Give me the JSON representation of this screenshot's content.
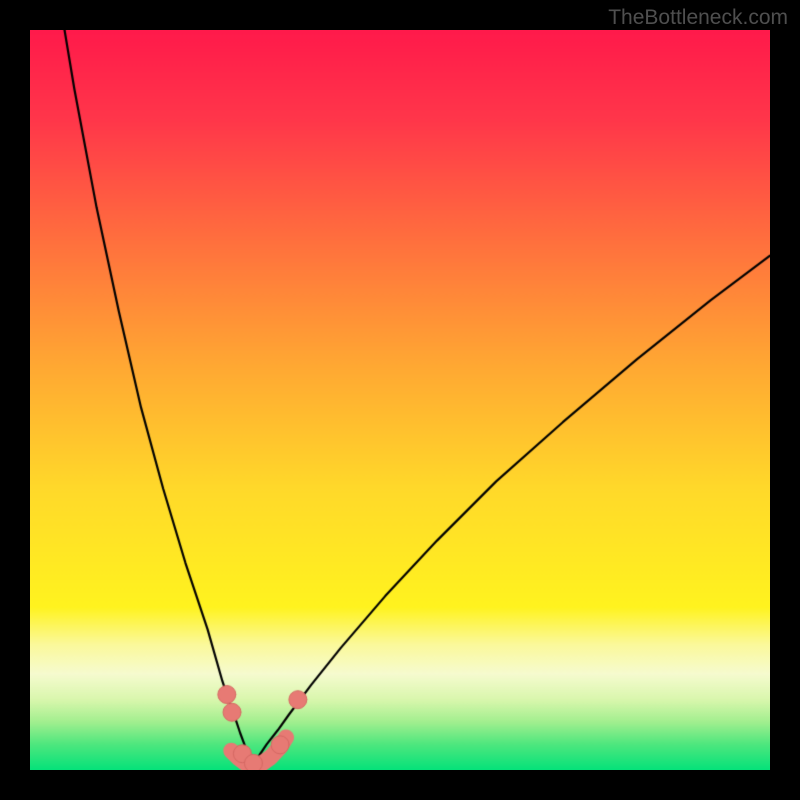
{
  "watermark": "TheBottleneck.com",
  "colors": {
    "black": "#000000",
    "curve": "#000000",
    "marker_fill": "#e77a74",
    "marker_stroke": "#d56863",
    "gradient_stops": [
      {
        "offset": 0.0,
        "color": "#ff1a4b"
      },
      {
        "offset": 0.12,
        "color": "#ff364a"
      },
      {
        "offset": 0.28,
        "color": "#ff6e3e"
      },
      {
        "offset": 0.45,
        "color": "#ffa733"
      },
      {
        "offset": 0.62,
        "color": "#ffd92a"
      },
      {
        "offset": 0.78,
        "color": "#fff31f"
      },
      {
        "offset": 0.83,
        "color": "#fbf99a"
      },
      {
        "offset": 0.87,
        "color": "#f6fbcf"
      },
      {
        "offset": 0.905,
        "color": "#d9f7ad"
      },
      {
        "offset": 0.935,
        "color": "#a2ef8f"
      },
      {
        "offset": 0.965,
        "color": "#4fe77e"
      },
      {
        "offset": 1.0,
        "color": "#05e27a"
      }
    ]
  },
  "chart_data": {
    "type": "line",
    "title": "",
    "xlabel": "",
    "ylabel": "",
    "xlim": [
      0,
      100
    ],
    "ylim": [
      0,
      100
    ],
    "x_of_min": 30,
    "left_curve": {
      "x": [
        0,
        3,
        6,
        9,
        12,
        15,
        18,
        21,
        24,
        26,
        27,
        27.8,
        28.4,
        29,
        29.5,
        30
      ],
      "y": [
        130,
        110,
        92,
        76,
        62,
        49,
        38,
        28,
        19,
        12,
        9,
        6.8,
        5.0,
        3.4,
        1.9,
        0.6
      ]
    },
    "right_curve": {
      "x": [
        30,
        31,
        32,
        33.5,
        35,
        38,
        42,
        48,
        55,
        63,
        72,
        82,
        92,
        100
      ],
      "y": [
        0.6,
        2.0,
        3.5,
        5.4,
        7.5,
        11.5,
        16.5,
        23.5,
        31,
        39,
        47,
        55.5,
        63.5,
        69.5
      ]
    },
    "basin_band": {
      "x": [
        27.2,
        28.2,
        29.0,
        29.8,
        30.6,
        31.5,
        32.5,
        33.7,
        34.6
      ],
      "y": [
        2.6,
        1.6,
        1.0,
        0.7,
        0.7,
        1.0,
        1.7,
        3.0,
        4.4
      ]
    },
    "markers": [
      {
        "x": 26.6,
        "y": 10.2
      },
      {
        "x": 27.3,
        "y": 7.8
      },
      {
        "x": 28.7,
        "y": 2.2
      },
      {
        "x": 30.2,
        "y": 0.9
      },
      {
        "x": 33.8,
        "y": 3.4
      },
      {
        "x": 36.2,
        "y": 9.5
      }
    ]
  }
}
